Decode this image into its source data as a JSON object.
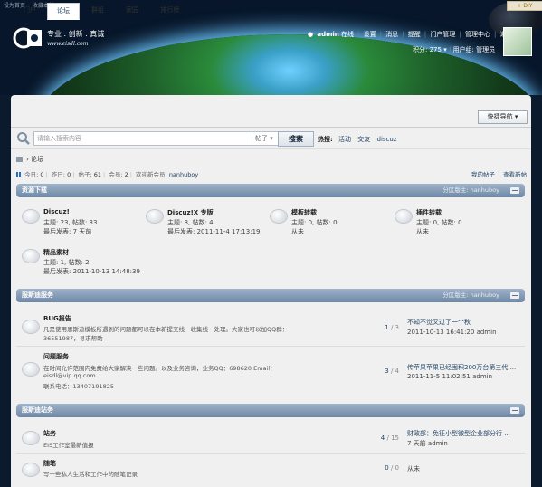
{
  "top": {
    "links": [
      "设为首页",
      "收藏本站"
    ],
    "diy": "+ DIY"
  },
  "brand": {
    "slogan": "专业 . 创新 . 真诚",
    "url": "www.eisdl.com"
  },
  "user": {
    "name": "admin",
    "suffix": "在线",
    "links": [
      "设置",
      "消息",
      "提醒",
      "门户管理",
      "管理中心",
      "退出"
    ],
    "credit": "积分: 275",
    "group": "用户组: 管理员"
  },
  "nav": {
    "tabs": [
      "门户",
      "论坛",
      "群组",
      "家园",
      "排行榜"
    ],
    "quick": "快捷导航"
  },
  "search": {
    "placeholder": "请输入搜索内容",
    "type": "帖子",
    "button": "搜索",
    "hot_label": "热搜:",
    "hot": [
      "活动",
      "交友",
      "discuz"
    ]
  },
  "crumb": {
    "current": "论坛"
  },
  "stats": {
    "today_label": "今日:",
    "today": "0",
    "yesterday_label": "昨日:",
    "yesterday": "0",
    "posts_label": "帖子:",
    "posts": "61",
    "members_label": "会员:",
    "members": "2",
    "welcome_label": "欢迎新会员:",
    "newest": "nanhuboy",
    "my_posts": "我的帖子",
    "view_new": "查看新帖"
  },
  "categories": [
    {
      "title": "资源下载",
      "moderator": "分区版主: nanhuboy",
      "forums": [
        {
          "name": "Discuz!",
          "stats": "主题: 23, 帖数: 33",
          "last": "最后发表: 7 天前"
        },
        {
          "name": "Discuz!X 专版",
          "stats": "主题: 3, 帖数: 4",
          "last": "最后发表: 2011-11-4 17:13:19"
        },
        {
          "name": "模板转载",
          "stats": "主题: 0, 帖数: 0",
          "last": "从未"
        },
        {
          "name": "插件转载",
          "stats": "主题: 0, 帖数: 0",
          "last": "从未"
        },
        {
          "name": "精品素材",
          "stats": "主题: 1, 帖数: 2",
          "last": "最后发表: 2011-10-13 14:48:39"
        }
      ]
    },
    {
      "title": "服斯迪服务",
      "moderator": "分区版主: nanhuboy",
      "forums": [
        {
          "name": "BUG报告",
          "desc": [
            "凡是使用恩斯迪模板所遇到的问题都可以在本新提交线一收集线一处理。大家也可以加QQ群：",
            "36551987，寻求帮助"
          ],
          "threads": "1",
          "posts": "3",
          "last_title": "不知不觉又过了一个秋",
          "last_meta": "2011-10-13 16:41:20 admin"
        },
        {
          "name": "问题服务",
          "desc": [
            "在时间允许范围内免费给大家解决一些问题。以及业务咨询，业务QQ：698620 Email：",
            "eisdl@vip.qq.com",
            "联系电话：13407191825"
          ],
          "threads": "3",
          "posts": "4",
          "last_title": "传苹果苹果已经囤积200万台第三代 ...",
          "last_meta": "2011-11-5 11:02:51 admin"
        }
      ]
    },
    {
      "title": "服斯迪站务",
      "moderator": "",
      "forums": [
        {
          "name": "站务",
          "desc": [
            "EIS工作室最新值报"
          ],
          "threads": "4",
          "posts": "15",
          "last_title": "财政部：免征小型微型企业部分行 ...",
          "last_meta": "7 天前 admin"
        },
        {
          "name": "随笔",
          "desc": [
            "写一些私人生活和工作中的随笔记录"
          ],
          "threads": "0",
          "posts": "0",
          "last_title": "从未",
          "last_meta": ""
        }
      ]
    }
  ]
}
